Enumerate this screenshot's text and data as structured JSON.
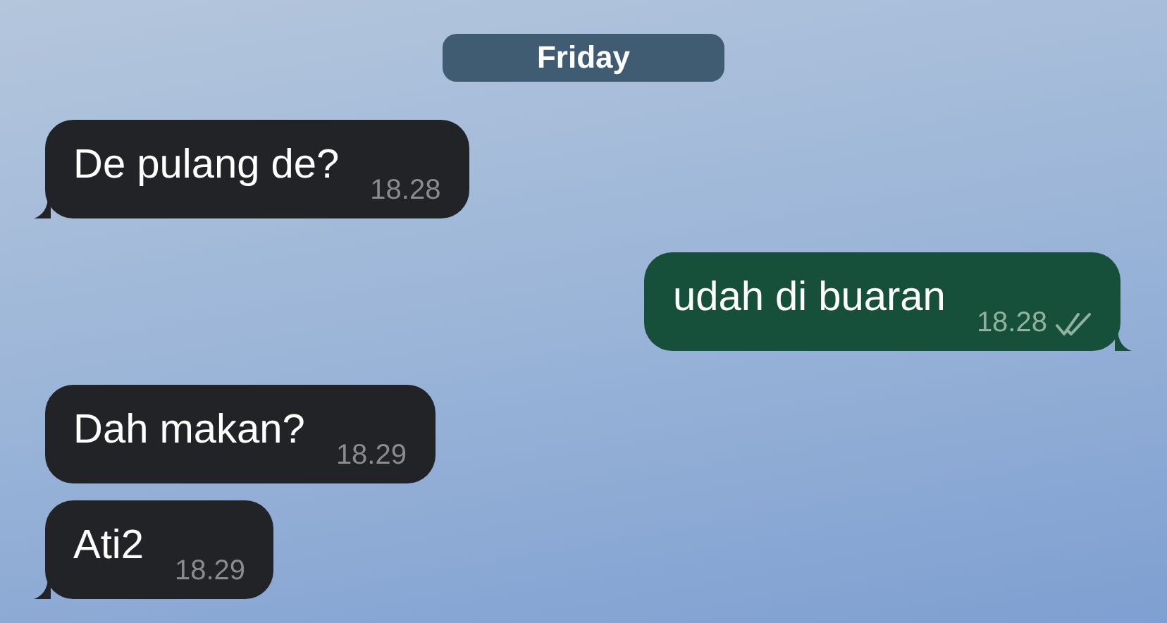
{
  "date_divider": {
    "label": "Friday"
  },
  "messages": [
    {
      "kind": "incoming",
      "text": "De pulang de?",
      "time": "18.28",
      "tail": true
    },
    {
      "kind": "outgoing",
      "text": "udah di buaran",
      "time": "18.28",
      "read": true,
      "tail": true
    },
    {
      "kind": "incoming",
      "text": "Dah makan?",
      "time": "18.29",
      "tail": false
    },
    {
      "kind": "incoming",
      "text": "Ati2",
      "time": "18.29",
      "tail": true
    }
  ]
}
